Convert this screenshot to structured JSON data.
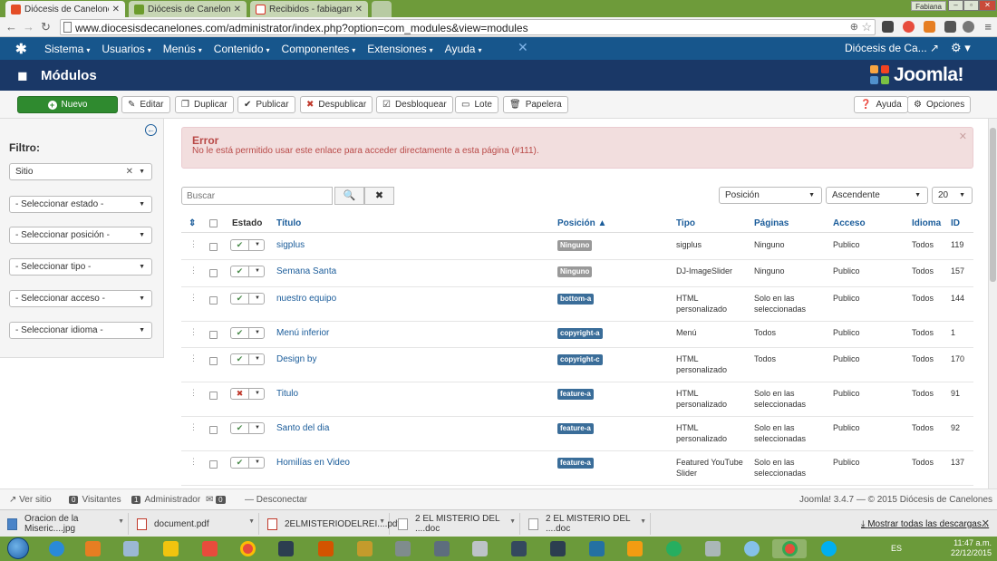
{
  "browser": {
    "tabs": [
      {
        "label": "Diócesis de Canelones - A",
        "active": true,
        "color": "#e44d26"
      },
      {
        "label": "Diócesis de Canelones",
        "active": false,
        "color": "#6c9c2c"
      },
      {
        "label": "Recibidos - fabiagarre@gm",
        "active": false,
        "color": "#d93025"
      }
    ],
    "user_label": "Fabiana",
    "url": "www.diocesisdecanelones.com/administrator/index.php?option=com_modules&view=modules",
    "window_controls": [
      "–",
      "▫",
      "✕"
    ]
  },
  "joomla_nav": {
    "menu": [
      "Sistema",
      "Usuarios",
      "Menús",
      "Contenido",
      "Componentes",
      "Extensiones",
      "Ayuda"
    ],
    "site_link": "Diócesis de Ca...",
    "site_link_icon": "↗"
  },
  "header": {
    "title": "Módulos",
    "logo_text": "Joomla!"
  },
  "toolbar": {
    "buttons": [
      {
        "label": "Nuevo",
        "icon": "+"
      },
      {
        "label": "Editar",
        "icon": "✎"
      },
      {
        "label": "Duplicar",
        "icon": "❐"
      },
      {
        "label": "Publicar",
        "icon": "✔"
      },
      {
        "label": "Despublicar",
        "icon": "✖"
      },
      {
        "label": "Desbloquear",
        "icon": "☑"
      },
      {
        "label": "Lote",
        "icon": "▭"
      },
      {
        "label": "Papelera",
        "icon": "🗑"
      }
    ],
    "help_label": "Ayuda",
    "options_label": "Opciones"
  },
  "sidebar": {
    "filter_label": "Filtro:",
    "client": "Sitio",
    "selects": [
      "- Seleccionar estado -",
      "- Seleccionar posición -",
      "- Seleccionar tipo -",
      "- Seleccionar acceso -",
      "- Seleccionar idioma -"
    ]
  },
  "alert": {
    "title": "Error",
    "message": "No le está permitido usar este enlace para acceder directamente a esta página (#111)."
  },
  "search": {
    "placeholder": "Buscar"
  },
  "sort": {
    "field": "Posición",
    "direction": "Ascendente",
    "limit": "20"
  },
  "table": {
    "headers": {
      "status": "Estado",
      "title": "Título",
      "position": "Posición",
      "type": "Tipo",
      "pages": "Páginas",
      "access": "Acceso",
      "language": "Idioma",
      "id": "ID"
    },
    "rows": [
      {
        "title": "sigplus",
        "position": "Ninguno",
        "type": "sigplus",
        "pages": "Ninguno",
        "access": "Publico",
        "language": "Todos",
        "id": "119",
        "published": true
      },
      {
        "title": "Semana Santa",
        "position": "Ninguno",
        "type": "DJ-ImageSlider",
        "pages": "Ninguno",
        "access": "Publico",
        "language": "Todos",
        "id": "157",
        "published": true
      },
      {
        "title": "nuestro equipo",
        "position": "bottom-a",
        "type": "HTML personalizado",
        "pages": "Solo en las seleccionadas",
        "access": "Publico",
        "language": "Todos",
        "id": "144",
        "published": true
      },
      {
        "title": "Menú inferior",
        "position": "copyright-a",
        "type": "Menú",
        "pages": "Todos",
        "access": "Publico",
        "language": "Todos",
        "id": "1",
        "published": true
      },
      {
        "title": "Design by",
        "position": "copyright-c",
        "type": "HTML personalizado",
        "pages": "Todos",
        "access": "Publico",
        "language": "Todos",
        "id": "170",
        "published": true
      },
      {
        "title": "Titulo",
        "position": "feature-a",
        "type": "HTML personalizado",
        "pages": "Solo en las seleccionadas",
        "access": "Publico",
        "language": "Todos",
        "id": "91",
        "published": false
      },
      {
        "title": "Santo del dia",
        "position": "feature-a",
        "type": "HTML personalizado",
        "pages": "Solo en las seleccionadas",
        "access": "Publico",
        "language": "Todos",
        "id": "92",
        "published": true
      },
      {
        "title": "Homilías en Video",
        "position": "feature-a",
        "type": "Featured YouTube Slider",
        "pages": "Solo en las seleccionadas",
        "access": "Publico",
        "language": "Todos",
        "id": "137",
        "published": true
      }
    ]
  },
  "status": {
    "view_site": "Ver sitio",
    "visitors_count": "0",
    "visitors_label": "Visitantes",
    "admin_count": "1",
    "admin_label": "Administrador",
    "messages_count": "0",
    "logout": "Desconectar",
    "version": "Joomla! 3.4.7 — © 2015 Diócesis de Canelones"
  },
  "downloads": {
    "items": [
      {
        "label": "Oracion de la Miseric....jpg",
        "kind": "img"
      },
      {
        "label": "document.pdf",
        "kind": "pdf"
      },
      {
        "label": "2ELMISTERIODELREI....pdf",
        "kind": "pdf"
      },
      {
        "label": "2 EL MISTERIO DEL ....doc",
        "kind": "doc"
      },
      {
        "label": "2 EL MISTERIO DEL ....doc",
        "kind": "doc"
      }
    ],
    "show_all": "Mostrar todas las descargas..."
  },
  "taskbar": {
    "lang": "ES",
    "time": "11:47 a.m.",
    "date": "22/12/2015"
  }
}
